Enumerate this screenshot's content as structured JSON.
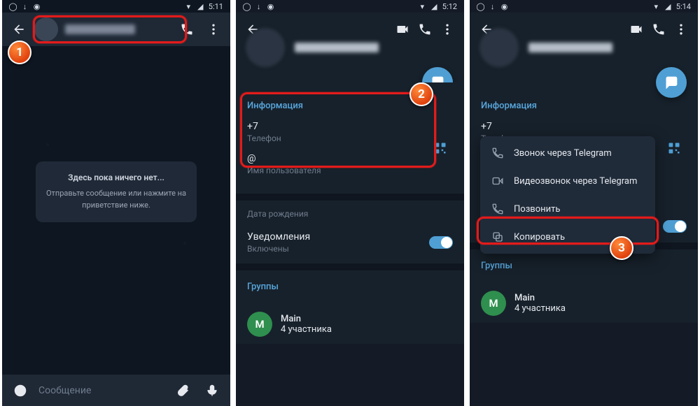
{
  "status": {
    "t1": "5:11",
    "t2": "5:12",
    "t3": "5:14"
  },
  "chat": {
    "empty_title": "Здесь пока ничего нет...",
    "empty_body": "Отправьте сообщение или нажмите на приветствие ниже.",
    "input_placeholder": "Сообщение"
  },
  "profile": {
    "info_title": "Информация",
    "phone_value": "+7",
    "phone_label": "Телефон",
    "username_value": "@",
    "username_label": "Имя пользователя",
    "birthday_label": "Дата рождения",
    "notifications_label": "Уведомления",
    "notifications_state": "Включены",
    "groups_title": "Группы",
    "group_name": "Main",
    "group_members": "4 участника",
    "group_initial": "M"
  },
  "ctx": {
    "call_telegram": "Звонок через Telegram",
    "video_telegram": "Видеозвонок через Telegram",
    "call": "Позвонить",
    "copy": "Копировать"
  },
  "steps": {
    "s1": "1",
    "s2": "2",
    "s3": "3"
  }
}
